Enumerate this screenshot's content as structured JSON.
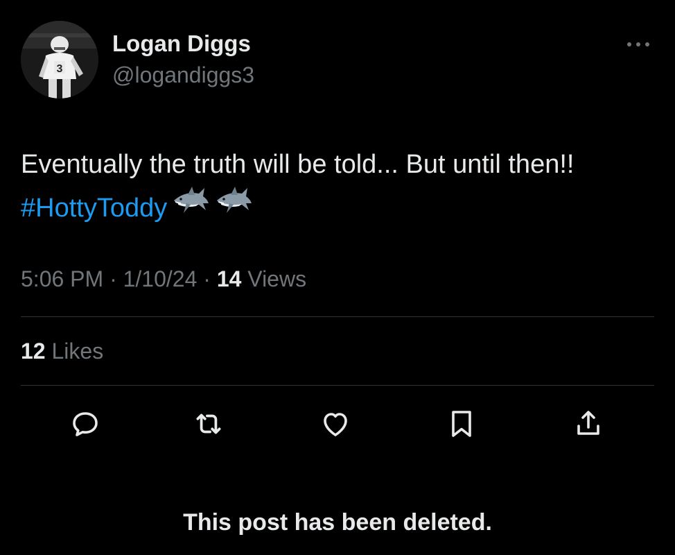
{
  "author": {
    "display_name": "Logan Diggs",
    "handle": "@logandiggs3",
    "avatar_icon": "football-player-photo"
  },
  "tweet": {
    "text_line1": "Eventually the truth will be told... But until then!!",
    "hashtag": "#HottyToddy",
    "emojis": [
      "shark-emoji",
      "shark-emoji"
    ]
  },
  "meta": {
    "time": "5:06 PM",
    "sep1": " · ",
    "date": "1/10/24",
    "sep2": " · ",
    "views_count": "14",
    "views_label": " Views"
  },
  "engagement": {
    "likes_count": "12",
    "likes_label": " Likes"
  },
  "actions": [
    "reply-icon",
    "retweet-icon",
    "like-icon",
    "bookmark-icon",
    "share-icon"
  ],
  "notice": "This post has been deleted.",
  "colors": {
    "background": "#000000",
    "text_primary": "#e7e9ea",
    "text_secondary": "#71767b",
    "link": "#1d9bf0",
    "divider": "#2f3336"
  }
}
